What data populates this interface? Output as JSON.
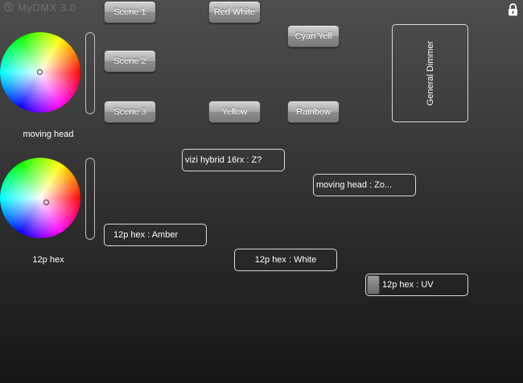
{
  "app": {
    "title": "MyDMX 3.0",
    "lock_icon": "lock-icon"
  },
  "color_wheels": [
    {
      "label": "moving head"
    },
    {
      "label": "12p hex"
    }
  ],
  "scenes": {
    "scene1": "Scene 1",
    "scene2": "Scene 2",
    "scene3": "Scene 3",
    "red_white": "Red White",
    "cyan_yell": "Cyan Yell",
    "yellow": "Yellow",
    "rainbow": "Rainbow"
  },
  "general_dimmer": "General Dimmer",
  "fixtures": {
    "vizi": "vizi hybrid 16rx : Z?",
    "moving_head": "moving head : Zo...",
    "hex_amber": "12p hex : Amber",
    "hex_white": "12p hex : White",
    "hex_uv": "12p hex : UV"
  },
  "colors": {
    "button_top": "#d4d4d4",
    "button_bottom": "#7a7a7a",
    "outline": "#d8d8d8",
    "title_gray": "#6e6e6e"
  }
}
